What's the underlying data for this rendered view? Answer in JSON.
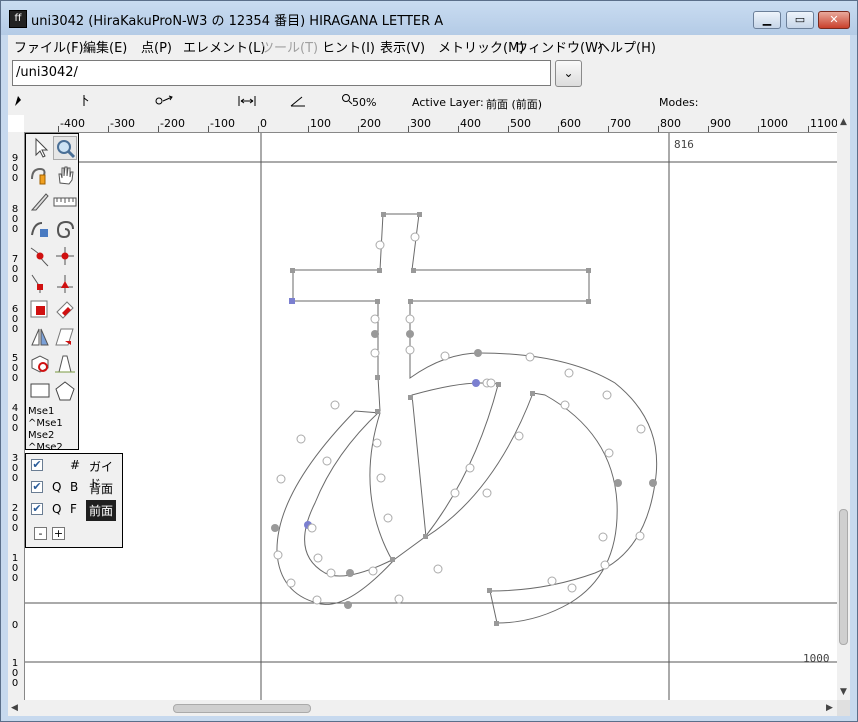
{
  "window": {
    "icon_label": "ff",
    "title": "uni3042 (HiraKakuProN-W3 の 12354 番目) HIRAGANA LETTER A",
    "min_icon": "minimize-icon",
    "max_icon": "maximize-icon",
    "close_icon": "close-icon"
  },
  "menu": [
    {
      "label": "ファイル(F)",
      "enabled": true
    },
    {
      "label": "編集(E)",
      "enabled": true
    },
    {
      "label": "点(P)",
      "enabled": true
    },
    {
      "label": "エレメント(L)",
      "enabled": true
    },
    {
      "label": "ツール(T)",
      "enabled": false
    },
    {
      "label": "ヒント(I)",
      "enabled": true
    },
    {
      "label": "表示(V)",
      "enabled": true
    },
    {
      "label": "メトリック(M)",
      "enabled": true
    },
    {
      "label": "ウィンドウ(W)",
      "enabled": true
    },
    {
      "label": "ヘルプ(H)",
      "enabled": true
    }
  ],
  "glyph_path": {
    "value": "/uni3042/",
    "dropdown_icon": "chevron-down-icon"
  },
  "infobar": {
    "zoom": "50%",
    "active_layer_label": "Active Layer:",
    "active_layer_value": "前面 (前面)",
    "modes_label": "Modes:"
  },
  "ruler": {
    "h_ticks": [
      "-400",
      "-300",
      "-200",
      "-100",
      "0",
      "100",
      "200",
      "300",
      "400",
      "500",
      "600",
      "700",
      "800",
      "900",
      "1000",
      "1100"
    ],
    "v_labels": [
      [
        "9",
        "0",
        "0"
      ],
      [
        "8",
        "0",
        "0"
      ],
      [
        "7",
        "0",
        "0"
      ],
      [
        "6",
        "0",
        "0"
      ],
      [
        "5",
        "0",
        "0"
      ],
      [
        "4",
        "0",
        "0"
      ],
      [
        "3",
        "0",
        "0"
      ],
      [
        "2",
        "0",
        "0"
      ],
      [
        "1",
        "0",
        "0"
      ],
      [
        "0"
      ],
      [
        "1",
        "0",
        "0"
      ]
    ]
  },
  "canvas": {
    "advance_label": "816",
    "height_label": "1000"
  },
  "toolbox": {
    "mse1": "Mse1",
    "cmse1": "^Mse1",
    "mse2": "Mse2",
    "cmse2": "^Mse2"
  },
  "layers": [
    {
      "q": "",
      "f": "#",
      "name": "ガイド",
      "checked": true,
      "active": false
    },
    {
      "q": "Q",
      "f": "B",
      "name": "背面",
      "checked": true,
      "active": false
    },
    {
      "q": "Q",
      "f": "F",
      "name": "前面",
      "checked": true,
      "active": true
    }
  ],
  "layer_buttons": {
    "remove": "-",
    "add": "+"
  },
  "colors": {
    "accent": "#1f1f1f",
    "point_selected": "#7b7fd0",
    "outline": "#6a6a6a"
  }
}
